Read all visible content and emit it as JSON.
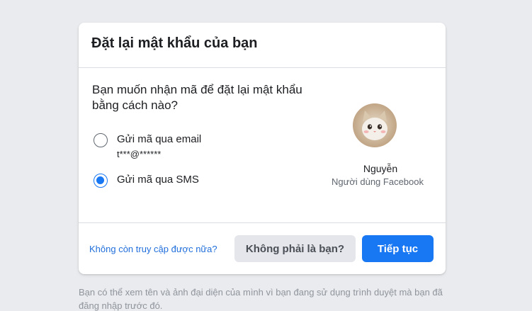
{
  "card": {
    "title": "Đặt lại mật khẩu của bạn",
    "question": "Bạn muốn nhận mã để đặt lại mật khẩu bằng cách nào?",
    "options": [
      {
        "label": "Gửi mã qua email",
        "detail": "t***@******",
        "selected": false
      },
      {
        "label": "Gửi mã qua SMS",
        "detail": "",
        "selected": true
      }
    ],
    "profile": {
      "name": "Nguyễn",
      "subtitle": "Người dùng Facebook"
    },
    "footer": {
      "link": "Không còn truy cập được nữa?",
      "not_you_button": "Không phải là bạn?",
      "continue_button": "Tiếp tục"
    }
  },
  "note": "Bạn có thể xem tên và ảnh đại diện của mình vì bạn đang sử dụng trình duyệt mà bạn đã đăng nhập trước đó.",
  "colors": {
    "accent": "#1877f2",
    "background": "#e9ebee",
    "link": "#216fdb"
  }
}
